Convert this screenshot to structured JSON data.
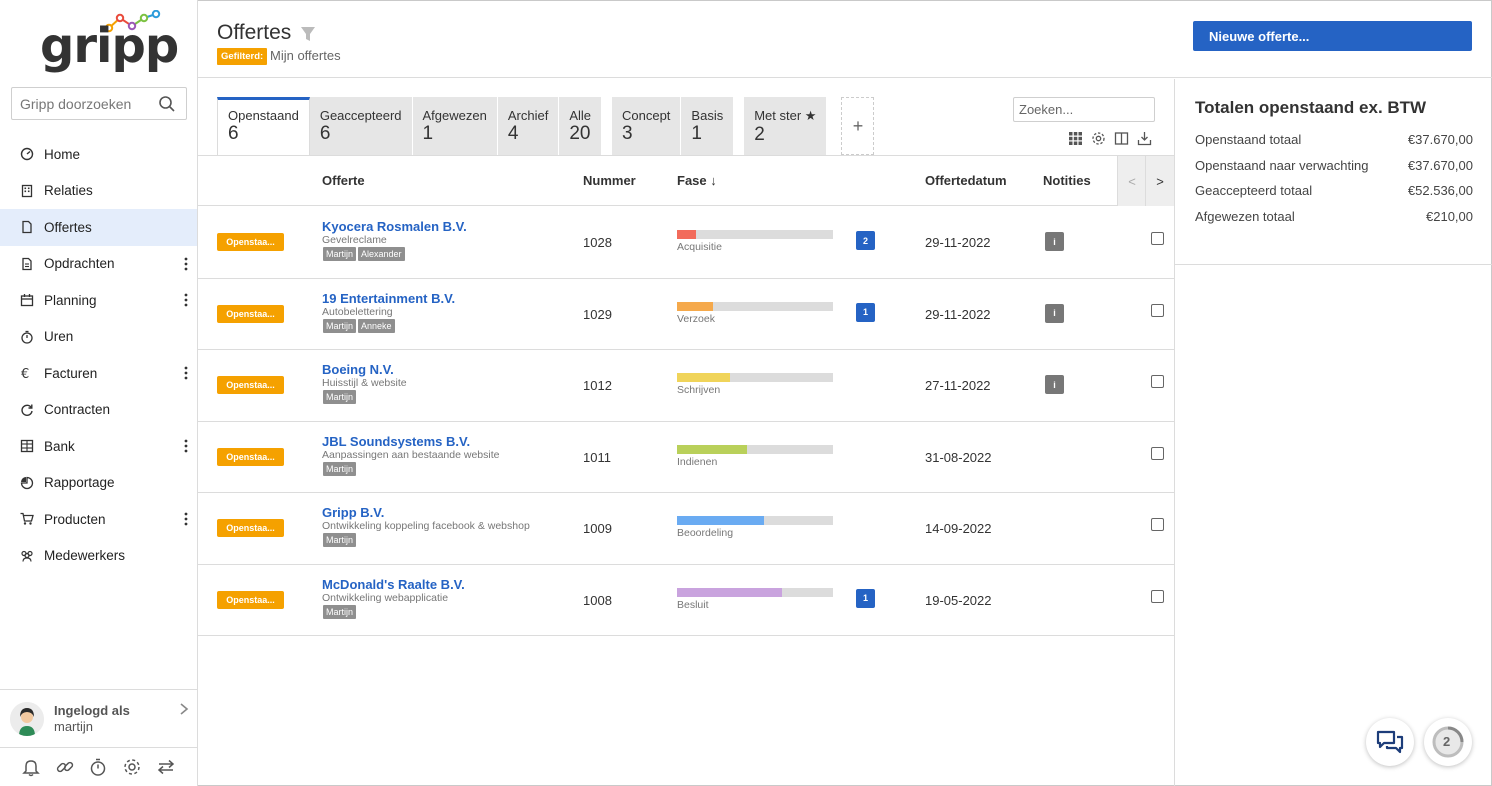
{
  "app": {
    "name": "gripp"
  },
  "sidebar": {
    "search_placeholder": "Gripp doorzoeken",
    "items": [
      {
        "label": "Home",
        "icon": "dashboard-icon",
        "active": false,
        "menu": false
      },
      {
        "label": "Relaties",
        "icon": "building-icon",
        "active": false,
        "menu": false
      },
      {
        "label": "Offertes",
        "icon": "document-icon",
        "active": true,
        "menu": false
      },
      {
        "label": "Opdrachten",
        "icon": "document-list-icon",
        "active": false,
        "menu": true
      },
      {
        "label": "Planning",
        "icon": "calendar-icon",
        "active": false,
        "menu": true
      },
      {
        "label": "Uren",
        "icon": "stopwatch-icon",
        "active": false,
        "menu": false
      },
      {
        "label": "Facturen",
        "icon": "euro-icon",
        "active": false,
        "menu": true
      },
      {
        "label": "Contracten",
        "icon": "refresh-icon",
        "active": false,
        "menu": false
      },
      {
        "label": "Bank",
        "icon": "bank-icon",
        "active": false,
        "menu": true
      },
      {
        "label": "Rapportage",
        "icon": "pie-chart-icon",
        "active": false,
        "menu": false
      },
      {
        "label": "Producten",
        "icon": "cart-icon",
        "active": false,
        "menu": true
      },
      {
        "label": "Medewerkers",
        "icon": "users-icon",
        "active": false,
        "menu": false
      }
    ],
    "user": {
      "line1": "Ingelogd als",
      "line2": "martijn"
    }
  },
  "header": {
    "title": "Offertes",
    "filter_badge": "Gefilterd:",
    "filter_text": "Mijn offertes",
    "new_button": "Nieuwe offerte..."
  },
  "tabs": [
    {
      "label": "Openstaand",
      "count": "6",
      "active": true
    },
    {
      "label": "Geaccepteerd",
      "count": "6",
      "active": false
    },
    {
      "label": "Afgewezen",
      "count": "1",
      "active": false
    },
    {
      "label": "Archief",
      "count": "4",
      "active": false
    },
    {
      "label": "Alle",
      "count": "20",
      "active": false
    },
    {
      "label": "Concept",
      "count": "3",
      "active": false
    },
    {
      "label": "Basis",
      "count": "1",
      "active": false
    },
    {
      "label": "Met ster ★",
      "count": "2",
      "active": false
    }
  ],
  "tab_add": "+",
  "search": {
    "placeholder": "Zoeken..."
  },
  "table": {
    "headers": {
      "offerte": "Offerte",
      "nummer": "Nummer",
      "fase": "Fase ↓",
      "datum": "Offertedatum",
      "notities": "Notities"
    },
    "pager_prev": "<",
    "pager_next": ">",
    "rows": [
      {
        "status": "Openstaa...",
        "name": "Kyocera Rosmalen B.V.",
        "sub": "Gevelreclame",
        "tags": [
          "Martijn",
          "Alexander"
        ],
        "number": "1028",
        "phase": "Acquisitie",
        "progress": 0.12,
        "color": "#f26b5b",
        "count": "2",
        "date": "29-11-2022",
        "note": "i"
      },
      {
        "status": "Openstaa...",
        "name": "19 Entertainment B.V.",
        "sub": "Autobelettering",
        "tags": [
          "Martijn",
          "Anneke"
        ],
        "number": "1029",
        "phase": "Verzoek",
        "progress": 0.23,
        "color": "#f5a94b",
        "count": "1",
        "date": "29-11-2022",
        "note": "i"
      },
      {
        "status": "Openstaa...",
        "name": "Boeing N.V.",
        "sub": "Huisstijl & website",
        "tags": [
          "Martijn"
        ],
        "number": "1012",
        "phase": "Schrijven",
        "progress": 0.34,
        "color": "#f0d45a",
        "count": "",
        "date": "27-11-2022",
        "note": "i"
      },
      {
        "status": "Openstaa...",
        "name": "JBL Soundsystems B.V.",
        "sub": "Aanpassingen aan bestaande website",
        "tags": [
          "Martijn"
        ],
        "number": "1011",
        "phase": "Indienen",
        "progress": 0.45,
        "color": "#b9d05a",
        "count": "",
        "date": "31-08-2022",
        "note": ""
      },
      {
        "status": "Openstaa...",
        "name": "Gripp B.V.",
        "sub": "Ontwikkeling koppeling facebook & webshop",
        "tags": [
          "Martijn"
        ],
        "number": "1009",
        "phase": "Beoordeling",
        "progress": 0.56,
        "color": "#6aabf2",
        "count": "",
        "date": "14-09-2022",
        "note": ""
      },
      {
        "status": "Openstaa...",
        "name": "McDonald's Raalte B.V.",
        "sub": "Ontwikkeling webapplicatie",
        "tags": [
          "Martijn"
        ],
        "number": "1008",
        "phase": "Besluit",
        "progress": 0.67,
        "color": "#c9a3de",
        "count": "1",
        "date": "19-05-2022",
        "note": ""
      }
    ]
  },
  "totals": {
    "title": "Totalen openstaand ex. BTW",
    "rows": [
      {
        "label": "Openstaand totaal",
        "value": "€37.670,00"
      },
      {
        "label": "Openstaand naar verwachting",
        "value": "€37.670,00"
      },
      {
        "label": "Geaccepteerd totaal",
        "value": "€52.536,00"
      },
      {
        "label": "Afgewezen totaal",
        "value": "€210,00"
      }
    ]
  },
  "help_badge": "2",
  "colors": {
    "accent": "#2563c4",
    "status": "#f5a100"
  }
}
